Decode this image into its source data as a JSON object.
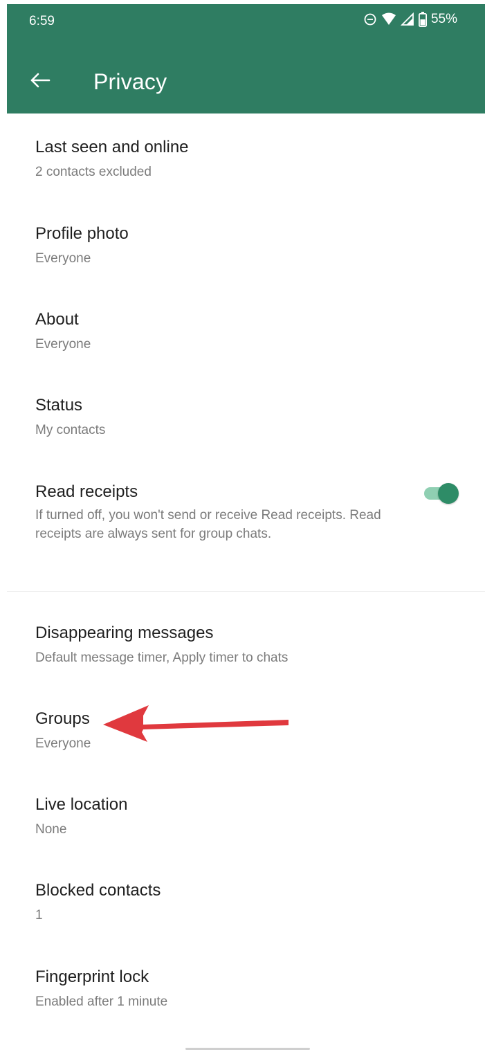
{
  "status_bar": {
    "time": "6:59",
    "battery": "55%",
    "icons": [
      "do-not-disturb-icon",
      "wifi-icon",
      "signal-icon",
      "battery-icon"
    ]
  },
  "header": {
    "back_icon": "arrow-left-icon",
    "title": "Privacy",
    "color": "#2f7d62"
  },
  "items": [
    {
      "title": "Last seen and online",
      "subtitle": "2 contacts excluded"
    },
    {
      "title": "Profile photo",
      "subtitle": "Everyone"
    },
    {
      "title": "About",
      "subtitle": "Everyone"
    },
    {
      "title": "Status",
      "subtitle": "My contacts"
    },
    {
      "title": "Read receipts",
      "subtitle": "If turned off, you won't send or receive Read receipts. Read receipts are always sent for group chats.",
      "toggle_on": true
    },
    {
      "title": "Disappearing messages",
      "subtitle": "Default message timer, Apply timer to chats"
    },
    {
      "title": "Groups",
      "subtitle": "Everyone"
    },
    {
      "title": "Live location",
      "subtitle": "None"
    },
    {
      "title": "Blocked contacts",
      "subtitle": "1"
    },
    {
      "title": "Fingerprint lock",
      "subtitle": "Enabled after 1 minute"
    }
  ],
  "annotation": {
    "type": "arrow",
    "color": "#e0393e",
    "points_to": "Groups"
  },
  "accent_color": "#2e8c67"
}
